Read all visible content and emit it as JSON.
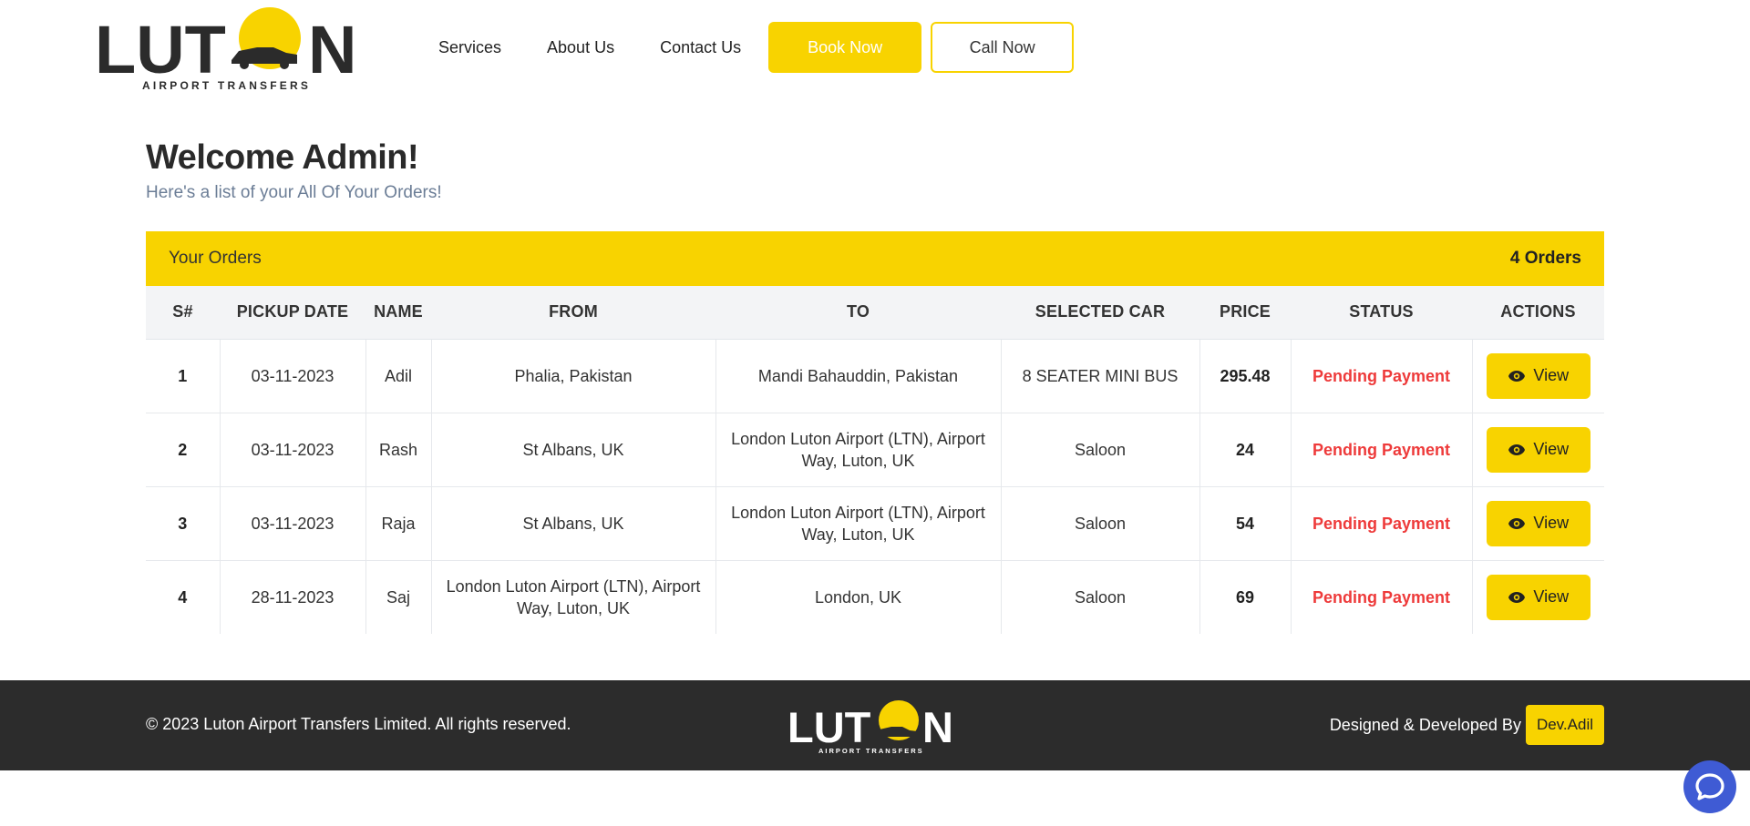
{
  "brand": {
    "logo_word_left": "LUT",
    "logo_word_right": "N",
    "logo_tagline": "AIRPORT TRANSFERS",
    "accent_color": "#f8d300"
  },
  "nav": {
    "items": [
      "Services",
      "About Us",
      "Contact Us"
    ],
    "book_label": "Book Now",
    "call_label": "Call Now"
  },
  "welcome": {
    "title": "Welcome Admin!",
    "subtitle": "Here's a list of your All Of Your Orders!"
  },
  "orders": {
    "header_title": "Your Orders",
    "count_label": "4 Orders",
    "columns": [
      "S#",
      "PICKUP DATE",
      "NAME",
      "FROM",
      "TO",
      "SELECTED CAR",
      "PRICE",
      "STATUS",
      "ACTIONS"
    ],
    "rows": [
      {
        "sn": "1",
        "date": "03-11-2023",
        "name": "Adil",
        "from": "Phalia, Pakistan",
        "to": "Mandi Bahauddin, Pakistan",
        "car": "8 SEATER MINI BUS",
        "price": "295.48",
        "status": "Pending Payment",
        "action": "View"
      },
      {
        "sn": "2",
        "date": "03-11-2023",
        "name": "Rash",
        "from": "St Albans, UK",
        "to": "London Luton Airport (LTN), Airport Way, Luton, UK",
        "car": "Saloon",
        "price": "24",
        "status": "Pending Payment",
        "action": "View"
      },
      {
        "sn": "3",
        "date": "03-11-2023",
        "name": "Raja",
        "from": "St Albans, UK",
        "to": "London Luton Airport (LTN), Airport Way, Luton, UK",
        "car": "Saloon",
        "price": "54",
        "status": "Pending Payment",
        "action": "View"
      },
      {
        "sn": "4",
        "date": "28-11-2023",
        "name": "Saj",
        "from": "London Luton Airport (LTN), Airport Way, Luton, UK",
        "to": "London, UK",
        "car": "Saloon",
        "price": "69",
        "status": "Pending Payment",
        "action": "View"
      }
    ],
    "status_color": "#ee3a3a",
    "view_icon": "eye-icon"
  },
  "footer": {
    "copyright": "© 2023 Luton Airport Transfers Limited. All rights reserved.",
    "credit_label": "Designed & Developed By",
    "developer": "Dev.Adil"
  },
  "chat_icon": "chat-bubble-icon"
}
